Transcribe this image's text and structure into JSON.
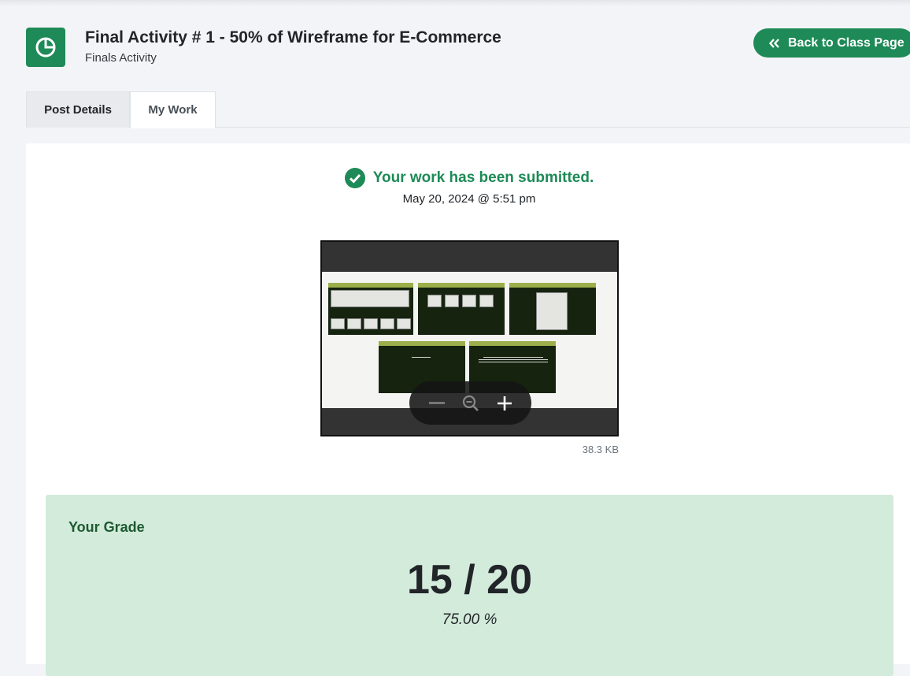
{
  "header": {
    "icon": "pie-chart-icon",
    "title": "Final Activity # 1 - 50% of Wireframe for E-Commerce",
    "subtitle": "Finals Activity",
    "back_button": "Back to Class Page",
    "back_icon": "double-chevron-left-icon"
  },
  "tabs": [
    {
      "label": "Post Details",
      "active": false
    },
    {
      "label": "My Work",
      "active": true
    }
  ],
  "submission": {
    "status": "Your work has been submitted.",
    "status_icon": "check-circle-icon",
    "date": "May 20, 2024 @ 5:51 pm",
    "file_size": "38.3 KB",
    "zoom_controls": [
      "minus-icon",
      "zoom-reset-icon",
      "plus-icon"
    ]
  },
  "grade": {
    "label": "Your Grade",
    "score": "15 / 20",
    "percent": "75.00 %"
  },
  "colors": {
    "brand": "#1e8a57",
    "grade_bg": "#d3ebdb",
    "grade_label": "#1d5a30"
  }
}
